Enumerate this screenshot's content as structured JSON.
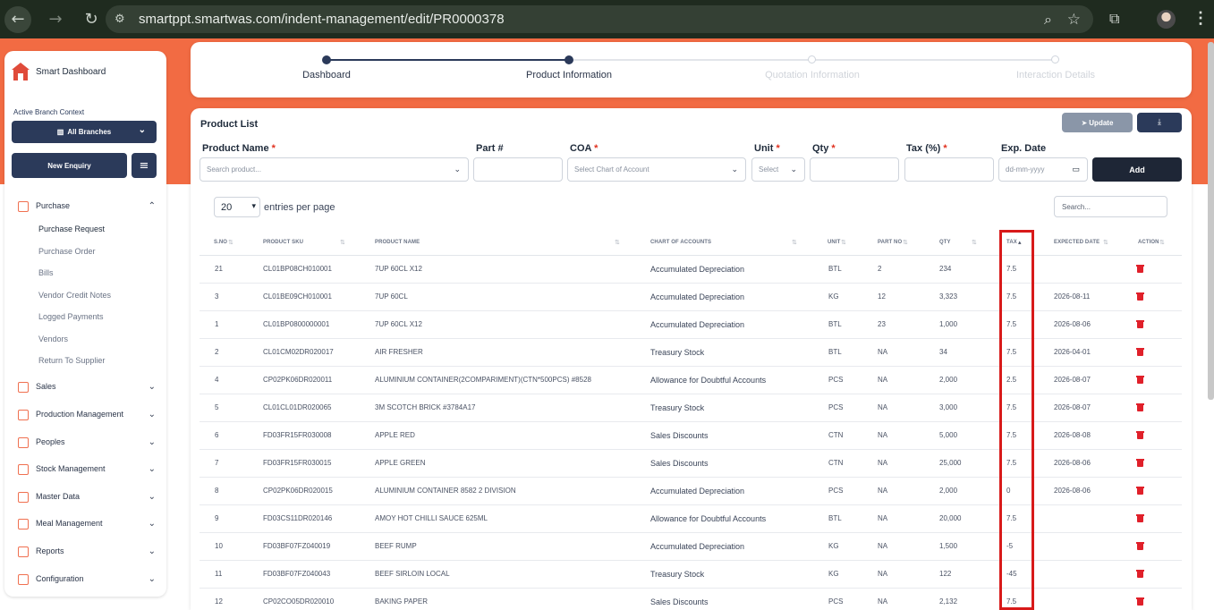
{
  "browser": {
    "url": "smartppt.smartwas.com/indent-management/edit/PR0000378"
  },
  "sidebar": {
    "brand": "Smart Dashboard",
    "context_label": "Active Branch Context",
    "branch_select": "All Branches",
    "new_enquiry": "New Enquiry",
    "menu": [
      {
        "label": "Purchase",
        "expanded": true
      },
      {
        "label": "Sales"
      },
      {
        "label": "Production Management"
      },
      {
        "label": "Peoples"
      },
      {
        "label": "Stock Management"
      },
      {
        "label": "Master Data"
      },
      {
        "label": "Meal Management"
      },
      {
        "label": "Reports"
      },
      {
        "label": "Configuration"
      }
    ],
    "purchase_sub": [
      "Purchase Request",
      "Purchase Order",
      "Bills",
      "Vendor Credit Notes",
      "Logged Payments",
      "Vendors",
      "Return To Supplier"
    ]
  },
  "stepper": {
    "steps": [
      "Dashboard",
      "Product Information",
      "Quotation Information",
      "Interaction Details"
    ],
    "active_index": 1
  },
  "product_list": {
    "title": "Product List",
    "update_label": "Update",
    "form": {
      "product_name_label": "Product Name",
      "product_name_placeholder": "Search product...",
      "part_label": "Part #",
      "coa_label": "COA",
      "coa_placeholder": "Select Chart of Account",
      "unit_label": "Unit",
      "unit_placeholder": "Select",
      "qty_label": "Qty",
      "tax_label": "Tax (%)",
      "exp_label": "Exp. Date",
      "exp_placeholder": "dd-mm-yyyy",
      "add_label": "Add",
      "required_mark": "*"
    },
    "entries_value": "20",
    "entries_text": "entries per page",
    "search_placeholder": "Search...",
    "columns": [
      "S.NO",
      "PRODUCT SKU",
      "PRODUCT NAME",
      "CHART OF ACCOUNTS",
      "UNIT",
      "PART NO",
      "QTY",
      "TAX",
      "EXPECTED DATE",
      "ACTION"
    ],
    "rows": [
      [
        "21",
        "CL01BP08CH010001",
        "7UP 60CL X12",
        "Accumulated Depreciation",
        "BTL",
        "2",
        "234",
        "7.5",
        ""
      ],
      [
        "3",
        "CL01BE09CH010001",
        "7UP 60CL",
        "Accumulated Depreciation",
        "KG",
        "12",
        "3,323",
        "7.5",
        "2026-08-11"
      ],
      [
        "1",
        "CL01BP0800000001",
        "7UP 60CL X12",
        "Accumulated Depreciation",
        "BTL",
        "23",
        "1,000",
        "7.5",
        "2026-08-06"
      ],
      [
        "2",
        "CL01CM02DR020017",
        "AIR FRESHER",
        "Treasury Stock",
        "BTL",
        "NA",
        "34",
        "7.5",
        "2026-04-01"
      ],
      [
        "4",
        "CP02PK06DR020011",
        "ALUMINIUM CONTAINER(2COMPARIMENT)(CTN*500PCS) #8528",
        "Allowance for Doubtful Accounts",
        "PCS",
        "NA",
        "2,000",
        "2.5",
        "2026-08-07"
      ],
      [
        "5",
        "CL01CL01DR020065",
        "3M SCOTCH BRICK #3784A17",
        "Treasury Stock",
        "PCS",
        "NA",
        "3,000",
        "7.5",
        "2026-08-07"
      ],
      [
        "6",
        "FD03FR15FR030008",
        "APPLE RED",
        "Sales Discounts",
        "CTN",
        "NA",
        "5,000",
        "7.5",
        "2026-08-08"
      ],
      [
        "7",
        "FD03FR15FR030015",
        "APPLE GREEN",
        "Sales Discounts",
        "CTN",
        "NA",
        "25,000",
        "7.5",
        "2026-08-06"
      ],
      [
        "8",
        "CP02PK06DR020015",
        "ALUMINIUM CONTAINER 8582 2 DIVISION",
        "Accumulated Depreciation",
        "PCS",
        "NA",
        "2,000",
        "0",
        "2026-08-06"
      ],
      [
        "9",
        "FD03CS11DR020146",
        "AMOY HOT CHILLI SAUCE 625ML",
        "Allowance for Doubtful Accounts",
        "BTL",
        "NA",
        "20,000",
        "7.5",
        ""
      ],
      [
        "10",
        "FD03BF07FZ040019",
        "BEEF RUMP",
        "Accumulated Depreciation",
        "KG",
        "NA",
        "1,500",
        "-5",
        ""
      ],
      [
        "11",
        "FD03BF07FZ040043",
        "BEEF SIRLOIN LOCAL",
        "Treasury Stock",
        "KG",
        "NA",
        "122",
        "-45",
        ""
      ],
      [
        "12",
        "CP02CO05DR020010",
        "BAKING PAPER",
        "Sales Discounts",
        "PCS",
        "NA",
        "2,132",
        "7.5",
        ""
      ]
    ]
  },
  "colors": {
    "accent": "#f26b43",
    "navy": "#2b3a5a",
    "highlight": "#d81a1a",
    "delete": "#e0202a"
  }
}
